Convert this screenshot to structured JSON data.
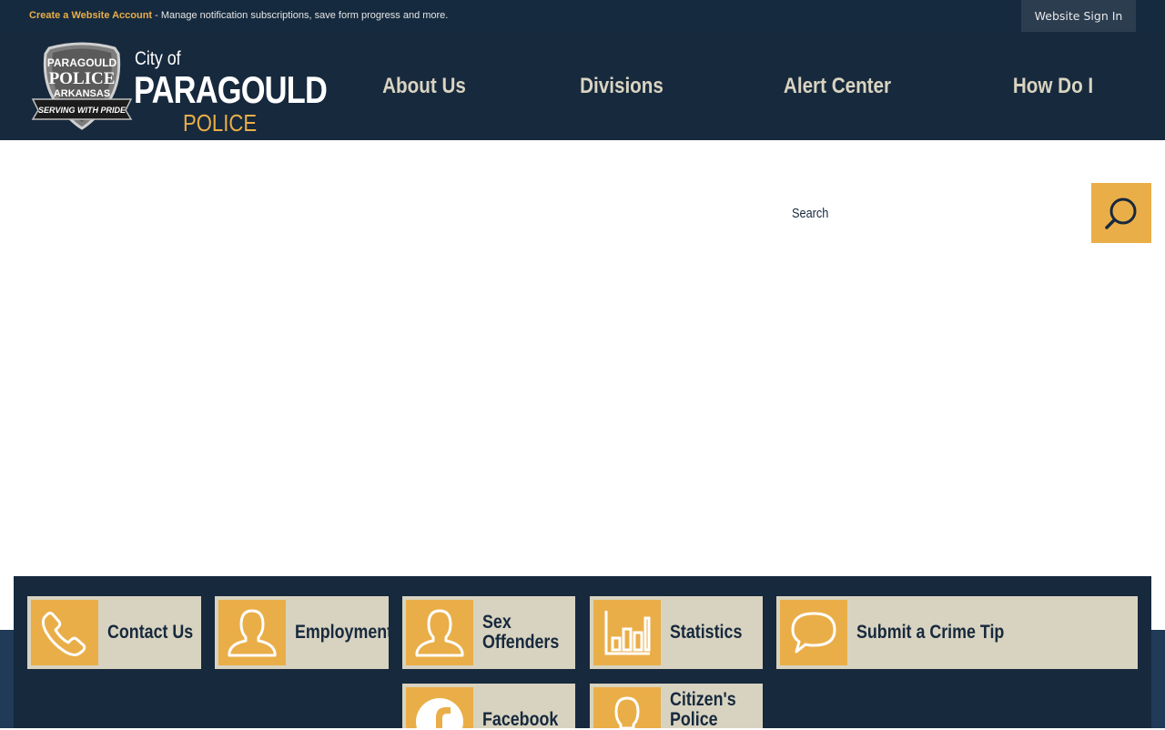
{
  "topbar": {
    "create_account_link": "Create a Website Account",
    "create_account_desc": " - Manage notification subscriptions, save form progress and more.",
    "sign_in": "Website Sign In"
  },
  "header": {
    "badge_line1": "PARAGOULD",
    "badge_line2": "POLICE",
    "badge_line3": "ARKANSAS",
    "badge_ribbon": "SERVING WITH PRIDE",
    "city_of": "City of",
    "city_name": "PARAGOULD",
    "city_sub": "POLICE",
    "nav": [
      "About Us",
      "Divisions",
      "Alert Center",
      "How Do I"
    ]
  },
  "search": {
    "label": "Search"
  },
  "quick_links": [
    {
      "label": "Contact Us",
      "icon": "phone-icon"
    },
    {
      "label": "Employment",
      "icon": "person-icon"
    },
    {
      "label": "Sex Offenders",
      "icon": "person-icon"
    },
    {
      "label": "Statistics",
      "icon": "bar-chart-icon"
    },
    {
      "label": "Submit a Crime Tip",
      "icon": "speech-bubble-icon"
    },
    {
      "label": "Facebook",
      "icon": "facebook-icon"
    },
    {
      "label": "Citizen's Police",
      "icon": "person-icon"
    }
  ],
  "colors": {
    "navy": "#17293d",
    "gold": "#eaae48",
    "tan": "#d8d3c0"
  }
}
